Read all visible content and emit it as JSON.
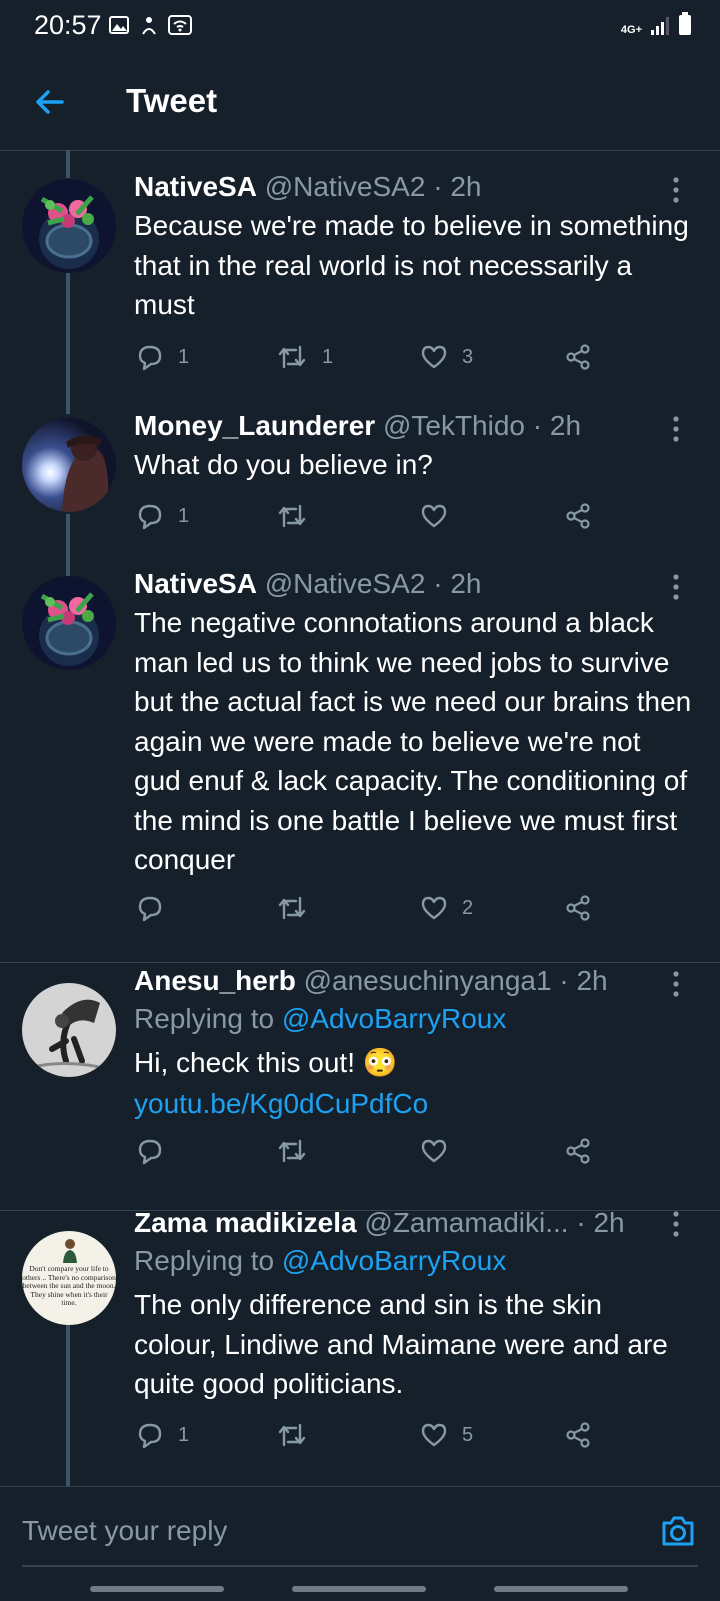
{
  "status_bar": {
    "time": "20:57",
    "network": "4G+"
  },
  "header": {
    "title": "Tweet"
  },
  "tweets": [
    {
      "name": "NativeSA",
      "handle": "@NativeSA2",
      "time": "· 2h",
      "replying_label": "",
      "replying_to": "",
      "text": "Because we're made to believe in something that in the real world is not necessarily a must",
      "link": "",
      "emoji": "",
      "replies": "1",
      "retweets": "1",
      "likes": "3"
    },
    {
      "name": "Money_Launderer",
      "handle": "@TekThido",
      "time": "· 2h",
      "replying_label": "",
      "replying_to": "",
      "text": "What do you believe in?",
      "link": "",
      "emoji": "",
      "replies": "1",
      "retweets": "",
      "likes": ""
    },
    {
      "name": "NativeSA",
      "handle": "@NativeSA2",
      "time": "· 2h",
      "replying_label": "",
      "replying_to": "",
      "text": "The negative connotations around a black man led us to think we need jobs to survive but the actual fact is we need our brains then again we were made to believe we're not gud enuf & lack capacity. The conditioning of the mind is one battle I believe we must first conquer",
      "link": "",
      "emoji": "",
      "replies": "",
      "retweets": "",
      "likes": "2"
    },
    {
      "name": "Anesu_herb",
      "handle": "@anesuchinyanga1",
      "time": "· 2h",
      "replying_label": "Replying to",
      "replying_to": "@AdvoBarryRoux",
      "text": "Hi,  check this out!",
      "emoji": "😳",
      "link": "youtu.be/Kg0dCuPdfCo",
      "replies": "",
      "retweets": "",
      "likes": ""
    },
    {
      "name": "Zama madikizela",
      "handle": "@Zamamadiki...",
      "time": "· 2h",
      "replying_label": "Replying to",
      "replying_to": "@AdvoBarryRoux",
      "text": "The only difference and sin is the skin colour, Lindiwe and Maimane were and are quite good politicians.",
      "link": "",
      "emoji": "",
      "replies": "1",
      "retweets": "",
      "likes": "5"
    }
  ],
  "avatar_texts": {
    "zama_quote": "Don't compare your life to others .. There's no comparison between the sun and the moon. They shine when it's their time."
  },
  "reply_box": {
    "placeholder": "Tweet your reply"
  },
  "colors": {
    "background": "#15202b",
    "accent": "#1da1f2",
    "secondary_text": "#8899a6",
    "divider": "#38444d"
  },
  "icons": [
    "back-arrow-icon",
    "more-vertical-icon",
    "reply-icon",
    "retweet-icon",
    "like-icon",
    "share-icon",
    "camera-icon"
  ]
}
